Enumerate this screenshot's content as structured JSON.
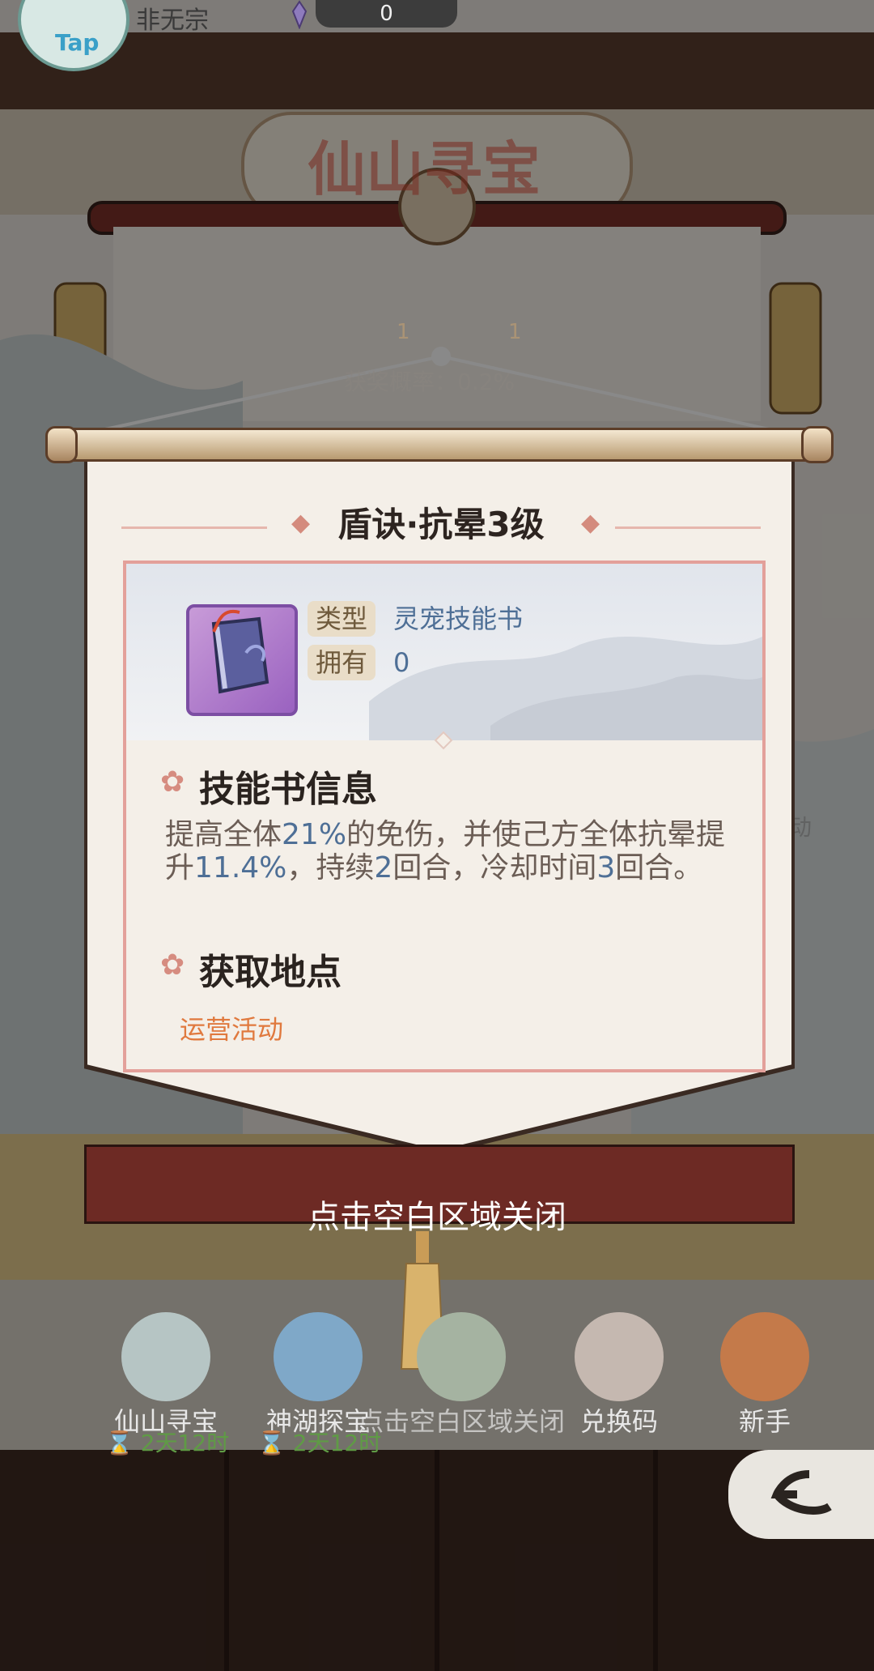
{
  "header": {
    "username": "非无宗",
    "currency_value": "0",
    "avatar_badge": "Tap"
  },
  "background": {
    "banner_title": "仙山寻宝",
    "item_counts": [
      "1",
      "1"
    ],
    "win_rate_text": "获奖概率：0.2%",
    "side_peek_text": "动"
  },
  "popup": {
    "title": "盾诀·抗晕3级",
    "type_label": "类型",
    "type_value": "灵宠技能书",
    "owned_label": "拥有",
    "owned_value": "0",
    "info_header": "技能书信息",
    "description_parts": [
      "提高全体",
      "21%",
      "的免伤，并使己方全体抗晕提升",
      "11.4%",
      "，持续",
      "2",
      "回合，冷却时间",
      "3",
      "回合。"
    ],
    "source_header": "获取地点",
    "source_value": "运营活动",
    "close_hint": "点击空白区域关闭"
  },
  "bottom_menu": {
    "items": [
      {
        "label": "仙山寻宝",
        "timer": "2天12时"
      },
      {
        "label": "神湖探宝",
        "timer": "2天12时"
      },
      {
        "label": "点击空白区域关闭"
      },
      {
        "label": "兑换码"
      },
      {
        "label": "新手"
      }
    ]
  },
  "colors": {
    "accent_blue": "#4e6f96",
    "source_orange": "#e0793e",
    "frame_red": "#6d2a24"
  }
}
